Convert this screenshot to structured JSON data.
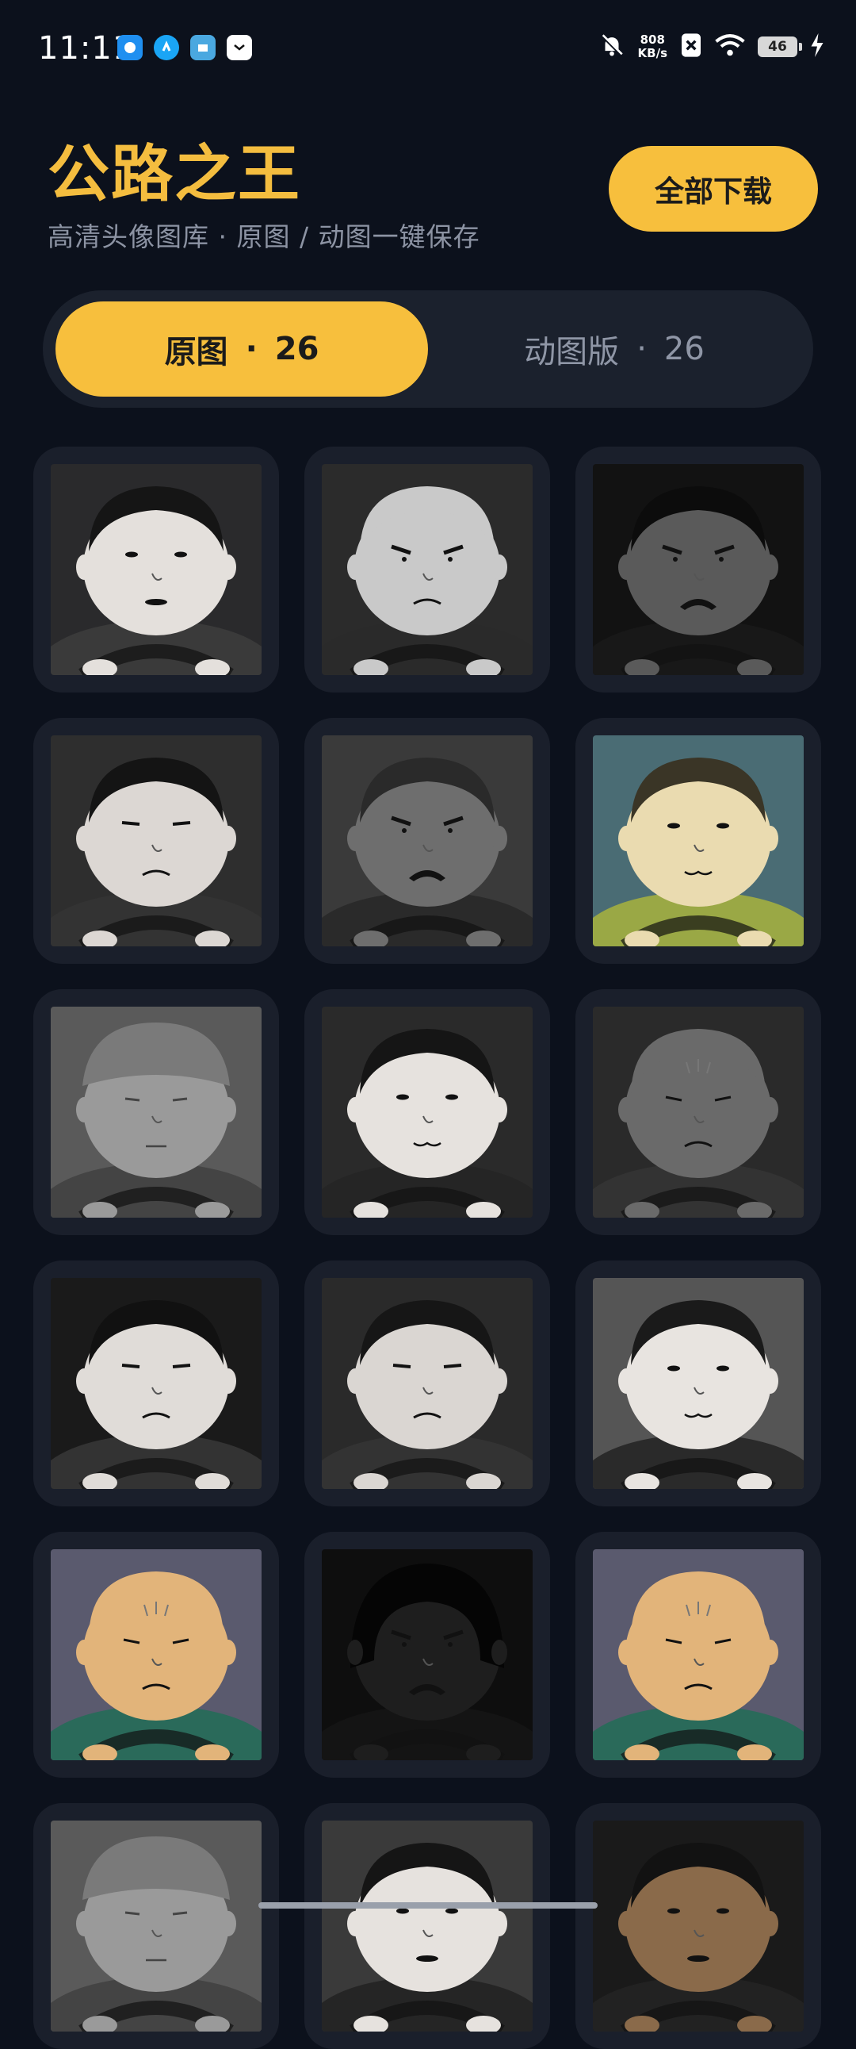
{
  "status_bar": {
    "time": "11:11",
    "net_speed_value": "808",
    "net_speed_unit": "KB/s",
    "battery": "46",
    "app_icons": [
      "app-icon-1",
      "app-icon-2",
      "app-icon-3",
      "app-icon-4"
    ]
  },
  "header": {
    "title": "公路之王",
    "subtitle": "高清头像图库 · 原图 / 动图一键保存",
    "download_label": "全部下载"
  },
  "tabs": [
    {
      "label": "原图",
      "count": "26",
      "active": true
    },
    {
      "label": "动图版",
      "count": "26",
      "active": false
    }
  ],
  "colors": {
    "accent": "#f7bf3d",
    "background": "#0c111c",
    "tile": "#1a1f2b",
    "muted_text": "#8c93a3"
  },
  "avatars": [
    {
      "skin": "#e4e0dc",
      "bg": "#2a2a2c",
      "hair": "#151515",
      "body": "#3a3a3a",
      "expr": "neutral"
    },
    {
      "skin": "#c9c9c9",
      "bg": "#2b2b2b",
      "hair": "#c9c9c9",
      "body": "#2a2a2a",
      "expr": "angry"
    },
    {
      "skin": "#5a5a5a",
      "bg": "#121212",
      "hair": "#0c0c0c",
      "body": "#181818",
      "expr": "mustache"
    },
    {
      "skin": "#dcd7d3",
      "bg": "#2e2e2e",
      "hair": "#141414",
      "body": "#333333",
      "expr": "frown"
    },
    {
      "skin": "#6e6e6e",
      "bg": "#3a3a3a",
      "hair": "#2a2a2a",
      "body": "#2a2a2a",
      "expr": "mustache"
    },
    {
      "skin": "#eadbb0",
      "bg": "#4a6c74",
      "hair": "#3a3526",
      "body": "#9aa845",
      "expr": "smile"
    },
    {
      "skin": "#9a9a9a",
      "bg": "#5a5a5a",
      "hair": "#7a7a7a",
      "body": "#444444",
      "expr": "cap"
    },
    {
      "skin": "#e6e2de",
      "bg": "#2a2a2a",
      "hair": "#151515",
      "body": "#252525",
      "expr": "smile"
    },
    {
      "skin": "#6a6a6a",
      "bg": "#2a2a2a",
      "hair": "#6a6a6a",
      "body": "#333333",
      "expr": "old"
    },
    {
      "skin": "#e0dcd8",
      "bg": "#1a1a1a",
      "hair": "#111111",
      "body": "#333333",
      "expr": "frown"
    },
    {
      "skin": "#dad6d2",
      "bg": "#2a2a2a",
      "hair": "#161616",
      "body": "#333333",
      "expr": "frown"
    },
    {
      "skin": "#e8e4e0",
      "bg": "#555555",
      "hair": "#1a1a1a",
      "body": "#2a2a2a",
      "expr": "smile"
    },
    {
      "skin": "#e2b47a",
      "bg": "#5a5a6e",
      "hair": "#e2b47a",
      "body": "#2a6a5a",
      "expr": "old"
    },
    {
      "skin": "#1e1e1e",
      "bg": "#0e0e0e",
      "hair": "#050505",
      "body": "#141414",
      "expr": "helmet"
    },
    {
      "skin": "#e2b47a",
      "bg": "#5a5a6e",
      "hair": "#e2b47a",
      "body": "#2a6a5a",
      "expr": "old"
    },
    {
      "skin": "#9a9a9a",
      "bg": "#5a5a5a",
      "hair": "#7a7a7a",
      "body": "#444444",
      "expr": "cap"
    },
    {
      "skin": "#e6e2de",
      "bg": "#3a3a3a",
      "hair": "#151515",
      "body": "#252525",
      "expr": "neutral"
    },
    {
      "skin": "#8a6a4a",
      "bg": "#1a1a1a",
      "hair": "#121212",
      "body": "#222222",
      "expr": "neutral"
    }
  ]
}
